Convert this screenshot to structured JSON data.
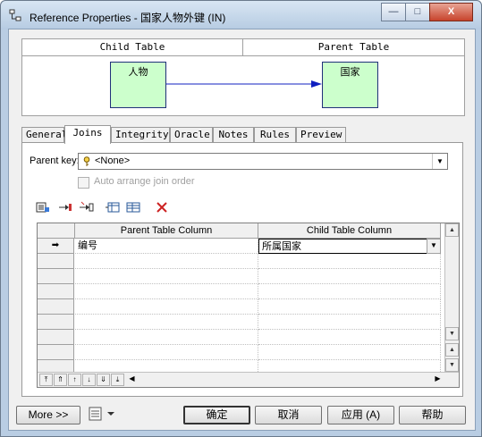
{
  "window": {
    "title": "Reference Properties - 国家人物外键 (IN)",
    "controls": {
      "minimize": "—",
      "maximize": "□",
      "close": "X"
    }
  },
  "diagram": {
    "child_header": "Child Table",
    "parent_header": "Parent Table",
    "child_entity": "人物",
    "parent_entity": "国家"
  },
  "tabs": [
    "General",
    "Joins",
    "Integrity",
    "Oracle",
    "Notes",
    "Rules",
    "Preview"
  ],
  "active_tab": "Joins",
  "joins": {
    "parent_key_label": "Parent key:",
    "parent_key_value": "<None>",
    "auto_arrange_label": "Auto arrange join order",
    "grid_headers": [
      "Parent Table Column",
      "Child Table Column"
    ],
    "rows": [
      {
        "parent": "编号",
        "child": "所属国家"
      }
    ]
  },
  "icons": {
    "app": "reference-icon",
    "key": "key-icon",
    "delete": "delete-icon"
  },
  "footer": {
    "more_label": "More >>",
    "ok_label": "确定",
    "cancel_label": "取消",
    "apply_label": "应用 (A)",
    "help_label": "帮助"
  },
  "colors": {
    "entity_fill": "#ccffcc",
    "entity_border": "#20307a",
    "link_color": "#1020c0",
    "close_button": "#c7432c"
  }
}
